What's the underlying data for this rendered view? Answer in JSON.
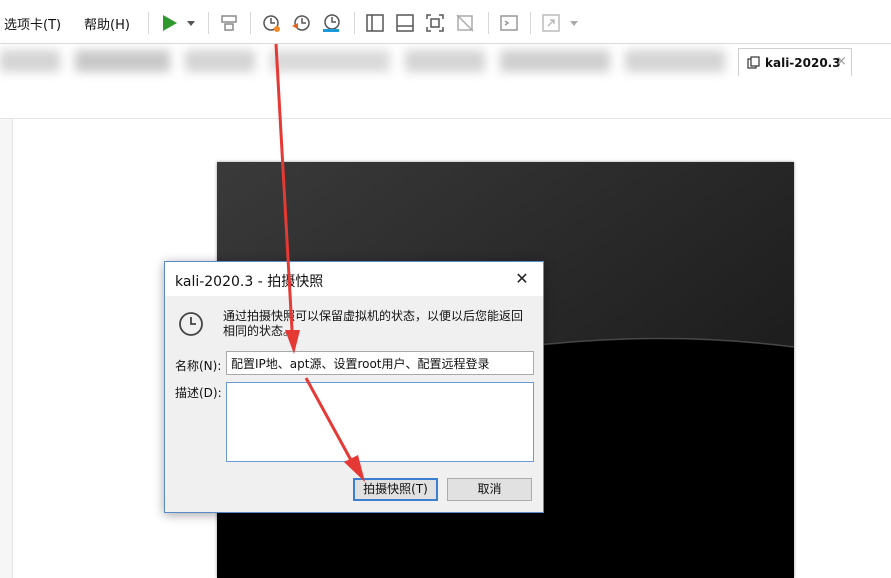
{
  "menubar": {
    "tabs_menu": "选项卡(T)",
    "help_menu": "帮助(H)"
  },
  "toolbar": {
    "icons": [
      "play-icon",
      "dropdown-icon",
      "send-keys-icon",
      "take-snapshot-icon",
      "revert-snapshot-icon",
      "snapshot-manager-icon",
      "view-console-icon",
      "view-split-icon",
      "fullscreen-icon",
      "unity-icon",
      "terminal-icon",
      "stretch-icon"
    ]
  },
  "vm_tab": {
    "label": "kali-2020.3",
    "close": "×"
  },
  "dialog": {
    "title": "kali-2020.3 - 拍摄快照",
    "close": "✕",
    "description": "通过拍摄快照可以保留虚拟机的状态，以便以后您能返回相同的状态。",
    "name_label": "名称(N):",
    "name_value": "配置IP地、apt源、设置root用户、配置远程登录",
    "desc_label": "描述(D):",
    "desc_value": "",
    "take_button": "拍摄快照(T)",
    "cancel_button": "取消"
  },
  "colors": {
    "play_green": "#2e9a2e",
    "dialog_border": "#5a8bc8",
    "primary_button_border": "#3c7fd1",
    "arrow_red": "#e53935"
  }
}
